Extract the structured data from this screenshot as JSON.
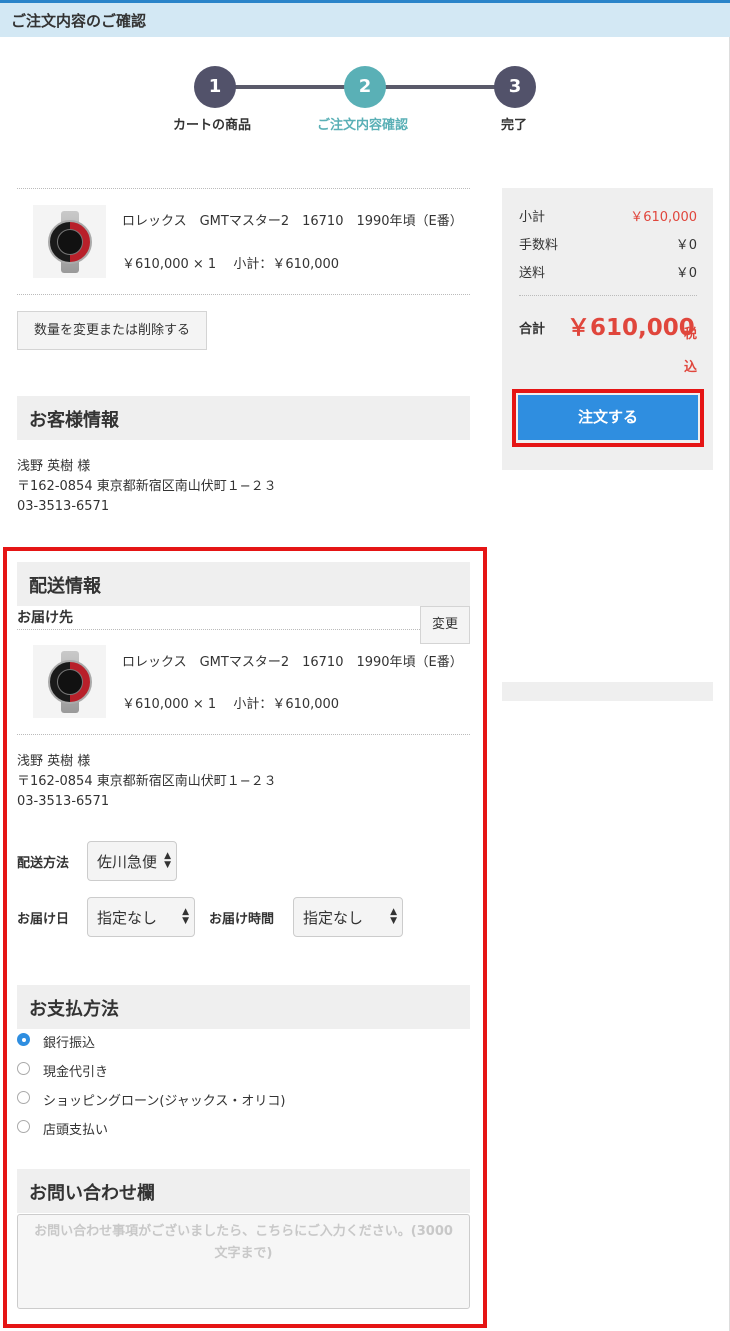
{
  "page_title": "ご注文内容のご確認",
  "steps": [
    {
      "number": "1",
      "label": "カートの商品"
    },
    {
      "number": "2",
      "label": "ご注文内容確認"
    },
    {
      "number": "3",
      "label": "完了"
    }
  ],
  "cart_item": {
    "name": "ロレックス　GMTマスター2　16710　1990年頃（E番）",
    "price_line": "￥610,000 × 1　 小計：￥610,000"
  },
  "change_qty_button": "数量を変更または削除する",
  "customer": {
    "heading": "お客様情報",
    "name": "浅野 英樹 様",
    "address": "〒162-0854 東京都新宿区南山伏町１−２３",
    "phone": "03-3513-6571"
  },
  "shipping": {
    "heading": "配送情報",
    "destination_label": "お届け先",
    "change_button": "変更",
    "item_name": "ロレックス　GMTマスター2　16710　1990年頃（E番）",
    "item_price_line": "￥610,000 × 1　 小計：￥610,000",
    "name": "浅野 英樹 様",
    "address": "〒162-0854 東京都新宿区南山伏町１−２３",
    "phone": "03-3513-6571",
    "method_label": "配送方法",
    "method_value": "佐川急便",
    "date_label": "お届け日",
    "date_value": "指定なし",
    "time_label": "お届け時間",
    "time_value": "指定なし"
  },
  "payment": {
    "heading": "お支払方法",
    "options": [
      {
        "label": "銀行振込",
        "checked": true
      },
      {
        "label": "現金代引き",
        "checked": false
      },
      {
        "label": "ショッピングローン(ジャックス・オリコ)",
        "checked": false
      },
      {
        "label": "店頭支払い",
        "checked": false
      }
    ]
  },
  "inquiry": {
    "heading": "お問い合わせ欄",
    "placeholder": "お問い合わせ事項がございましたら、こちらにご入力ください。(3000文字まで)"
  },
  "summary": {
    "subtotal_label": "小計",
    "subtotal_value": "￥610,000",
    "fee_label": "手数料",
    "fee_value": "￥0",
    "shipping_label": "送料",
    "shipping_value": "￥0",
    "total_label": "合計",
    "total_value": "￥610,000",
    "tax_label": "税込"
  },
  "order_button": "注文する",
  "colors": {
    "accent_blue": "#2f8ee0",
    "price_red": "#e0463c",
    "step_active": "#5ab0b6",
    "step_inactive": "#52526a",
    "highlight_red": "#e51515"
  }
}
